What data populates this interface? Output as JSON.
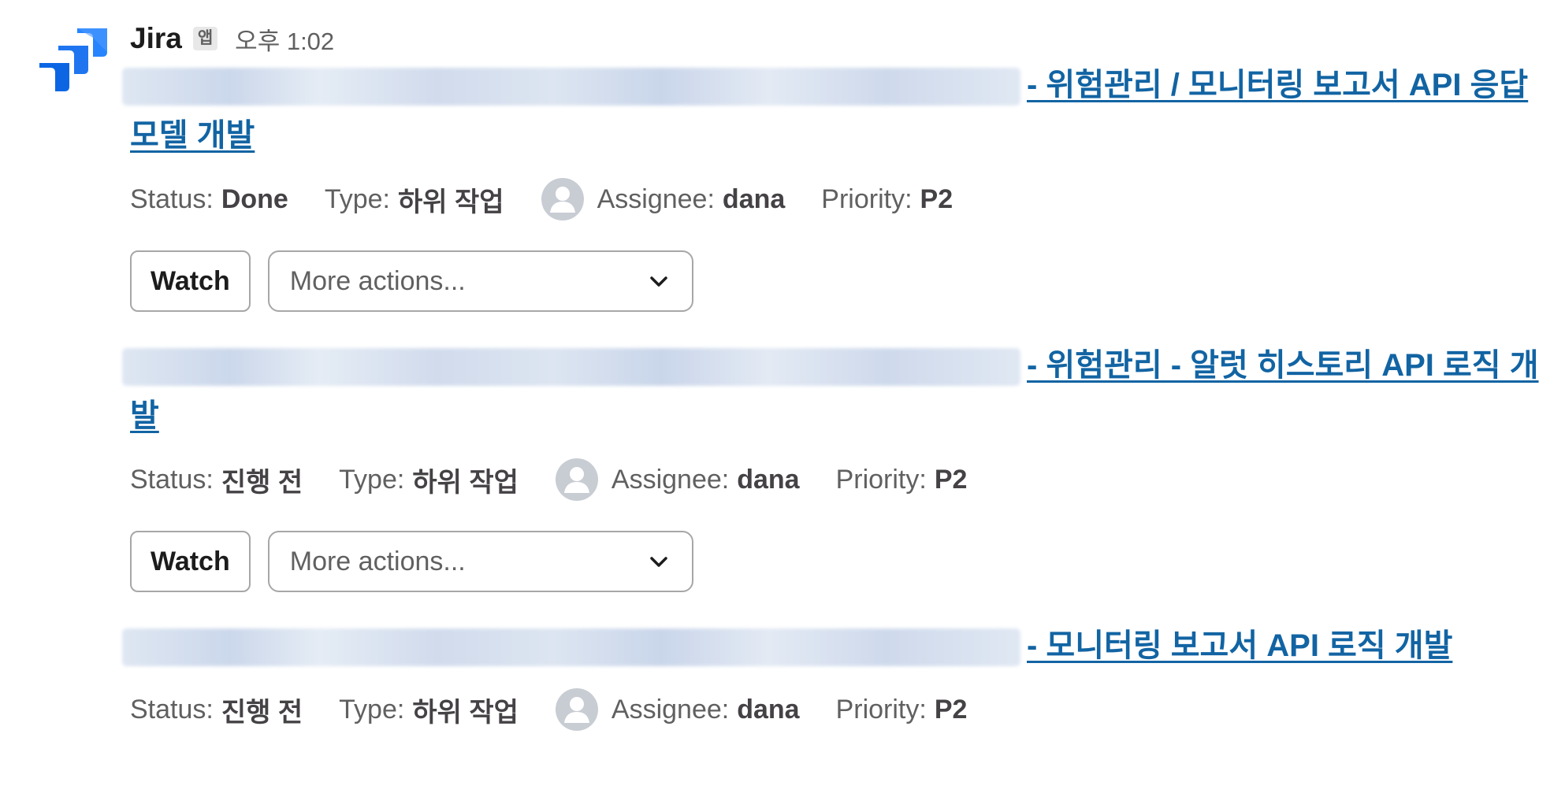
{
  "app": {
    "name": "Jira",
    "badge": "앱",
    "time": "오후 1:02",
    "brand_color": "#2684FF",
    "icon": "jira-logo"
  },
  "issues": [
    {
      "title": "- 위험관리 / 모니터링 보고서 API 응답 모델 개발",
      "status_label": "Status:",
      "status": "Done",
      "type_label": "Type:",
      "type": "하위 작업",
      "assignee_label": "Assignee:",
      "assignee": "dana",
      "priority_label": "Priority:",
      "priority": "P2",
      "watch_label": "Watch",
      "more_actions": "More actions..."
    },
    {
      "title": "- 위험관리 - 알럿 히스토리 API 로직 개발",
      "status_label": "Status:",
      "status": "진행 전",
      "type_label": "Type:",
      "type": "하위 작업",
      "assignee_label": "Assignee:",
      "assignee": "dana",
      "priority_label": "Priority:",
      "priority": "P2",
      "watch_label": "Watch",
      "more_actions": "More actions..."
    },
    {
      "title": "- 모니터링 보고서 API 로직 개발",
      "status_label": "Status:",
      "status": "진행 전",
      "type_label": "Type:",
      "type": "하위 작업",
      "assignee_label": "Assignee:",
      "assignee": "dana",
      "priority_label": "Priority:",
      "priority": "P2"
    }
  ],
  "colors": {
    "link": "#1264a3",
    "muted": "#616061",
    "border": "#a7a7a7"
  }
}
